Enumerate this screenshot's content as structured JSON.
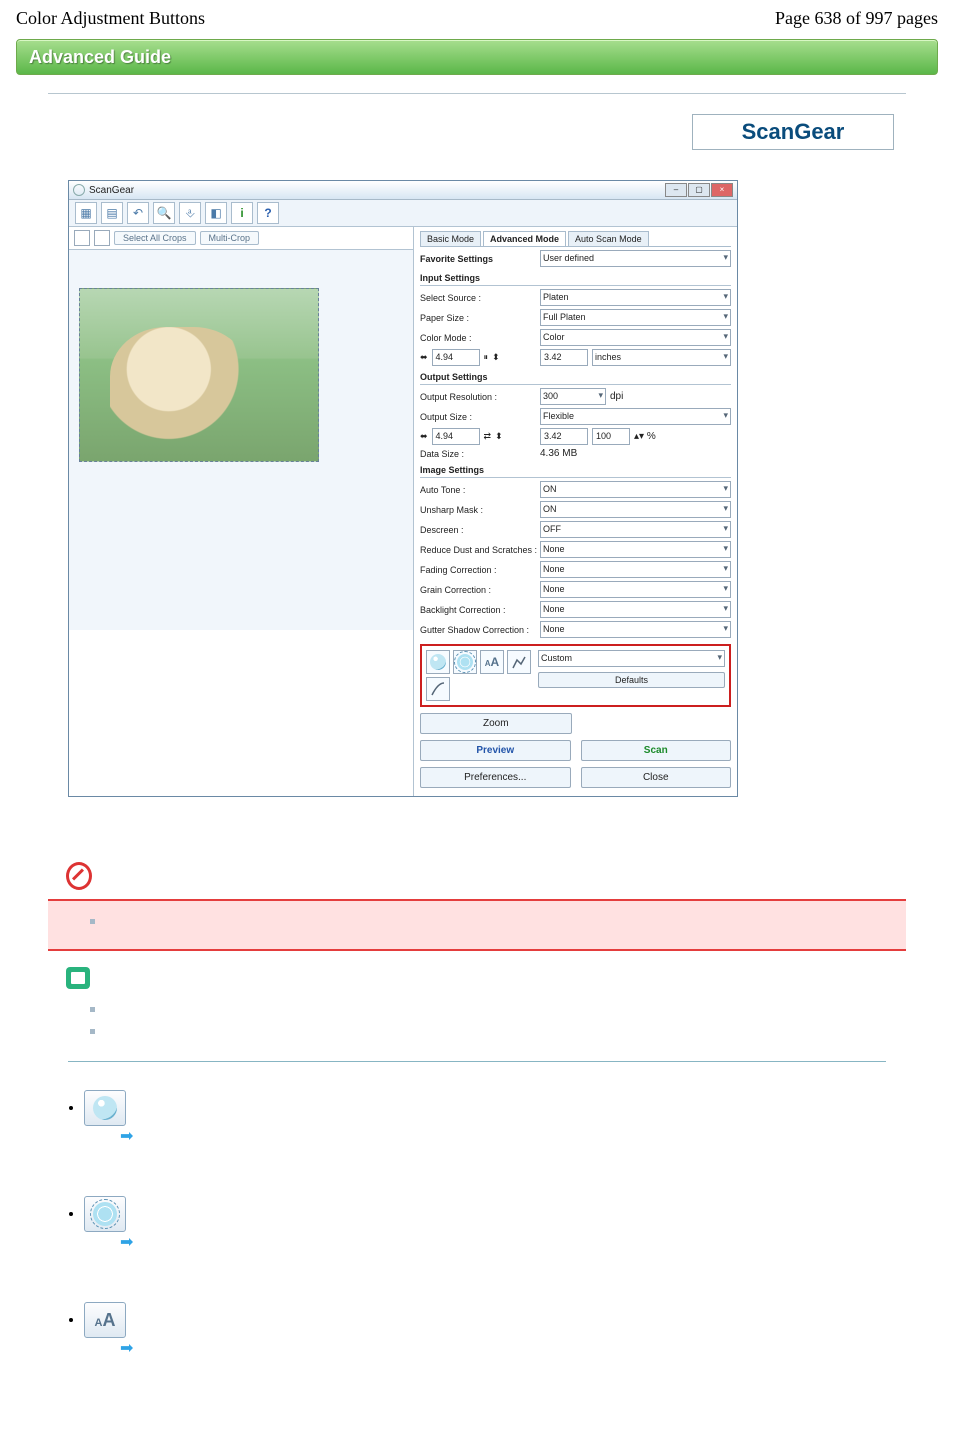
{
  "page": {
    "title": "Color Adjustment Buttons",
    "counter": "Page 638 of 997 pages",
    "banner": "Advanced Guide",
    "product": "ScanGear"
  },
  "screenshot": {
    "window_title": "ScanGear",
    "toolbar_icons": [
      "thumb-icon",
      "grid-icon",
      "rotate-left-icon",
      "zoom-icon",
      "ruler-icon",
      "color-icon",
      "info-icon",
      "help-icon"
    ],
    "left_buttons": {
      "select_all": "Select All Crops",
      "multi_crop": "Multi-Crop"
    },
    "tabs": {
      "basic": "Basic Mode",
      "advanced": "Advanced Mode",
      "auto": "Auto Scan Mode"
    },
    "favorite": {
      "label": "Favorite Settings",
      "value": "User defined"
    },
    "input": {
      "header": "Input Settings",
      "source_l": "Select Source :",
      "source_v": "Platen",
      "paper_l": "Paper Size :",
      "paper_v": "Full Platen",
      "mode_l": "Color Mode :",
      "mode_v": "Color",
      "w": "4.94",
      "h": "3.42",
      "unit": "inches"
    },
    "output": {
      "header": "Output Settings",
      "res_l": "Output Resolution :",
      "res_v": "300",
      "res_u": "dpi",
      "size_l": "Output Size :",
      "size_v": "Flexible",
      "w": "4.94",
      "h": "3.42",
      "pct": "100",
      "data_l": "Data Size :",
      "data_v": "4.36 MB"
    },
    "image": {
      "header": "Image Settings",
      "rows": [
        {
          "l": "Auto Tone :",
          "v": "ON"
        },
        {
          "l": "Unsharp Mask :",
          "v": "ON"
        },
        {
          "l": "Descreen :",
          "v": "OFF"
        },
        {
          "l": "Reduce Dust and Scratches :",
          "v": "None"
        },
        {
          "l": "Fading Correction :",
          "v": "None"
        },
        {
          "l": "Grain Correction :",
          "v": "None"
        },
        {
          "l": "Backlight Correction :",
          "v": "None"
        },
        {
          "l": "Gutter Shadow Correction :",
          "v": "None"
        }
      ]
    },
    "color_buttons": {
      "custom": "Custom",
      "defaults": "Defaults"
    },
    "actions": {
      "zoom": "Zoom",
      "preview": "Preview",
      "scan": "Scan",
      "prefs": "Preferences...",
      "close": "Close"
    }
  }
}
